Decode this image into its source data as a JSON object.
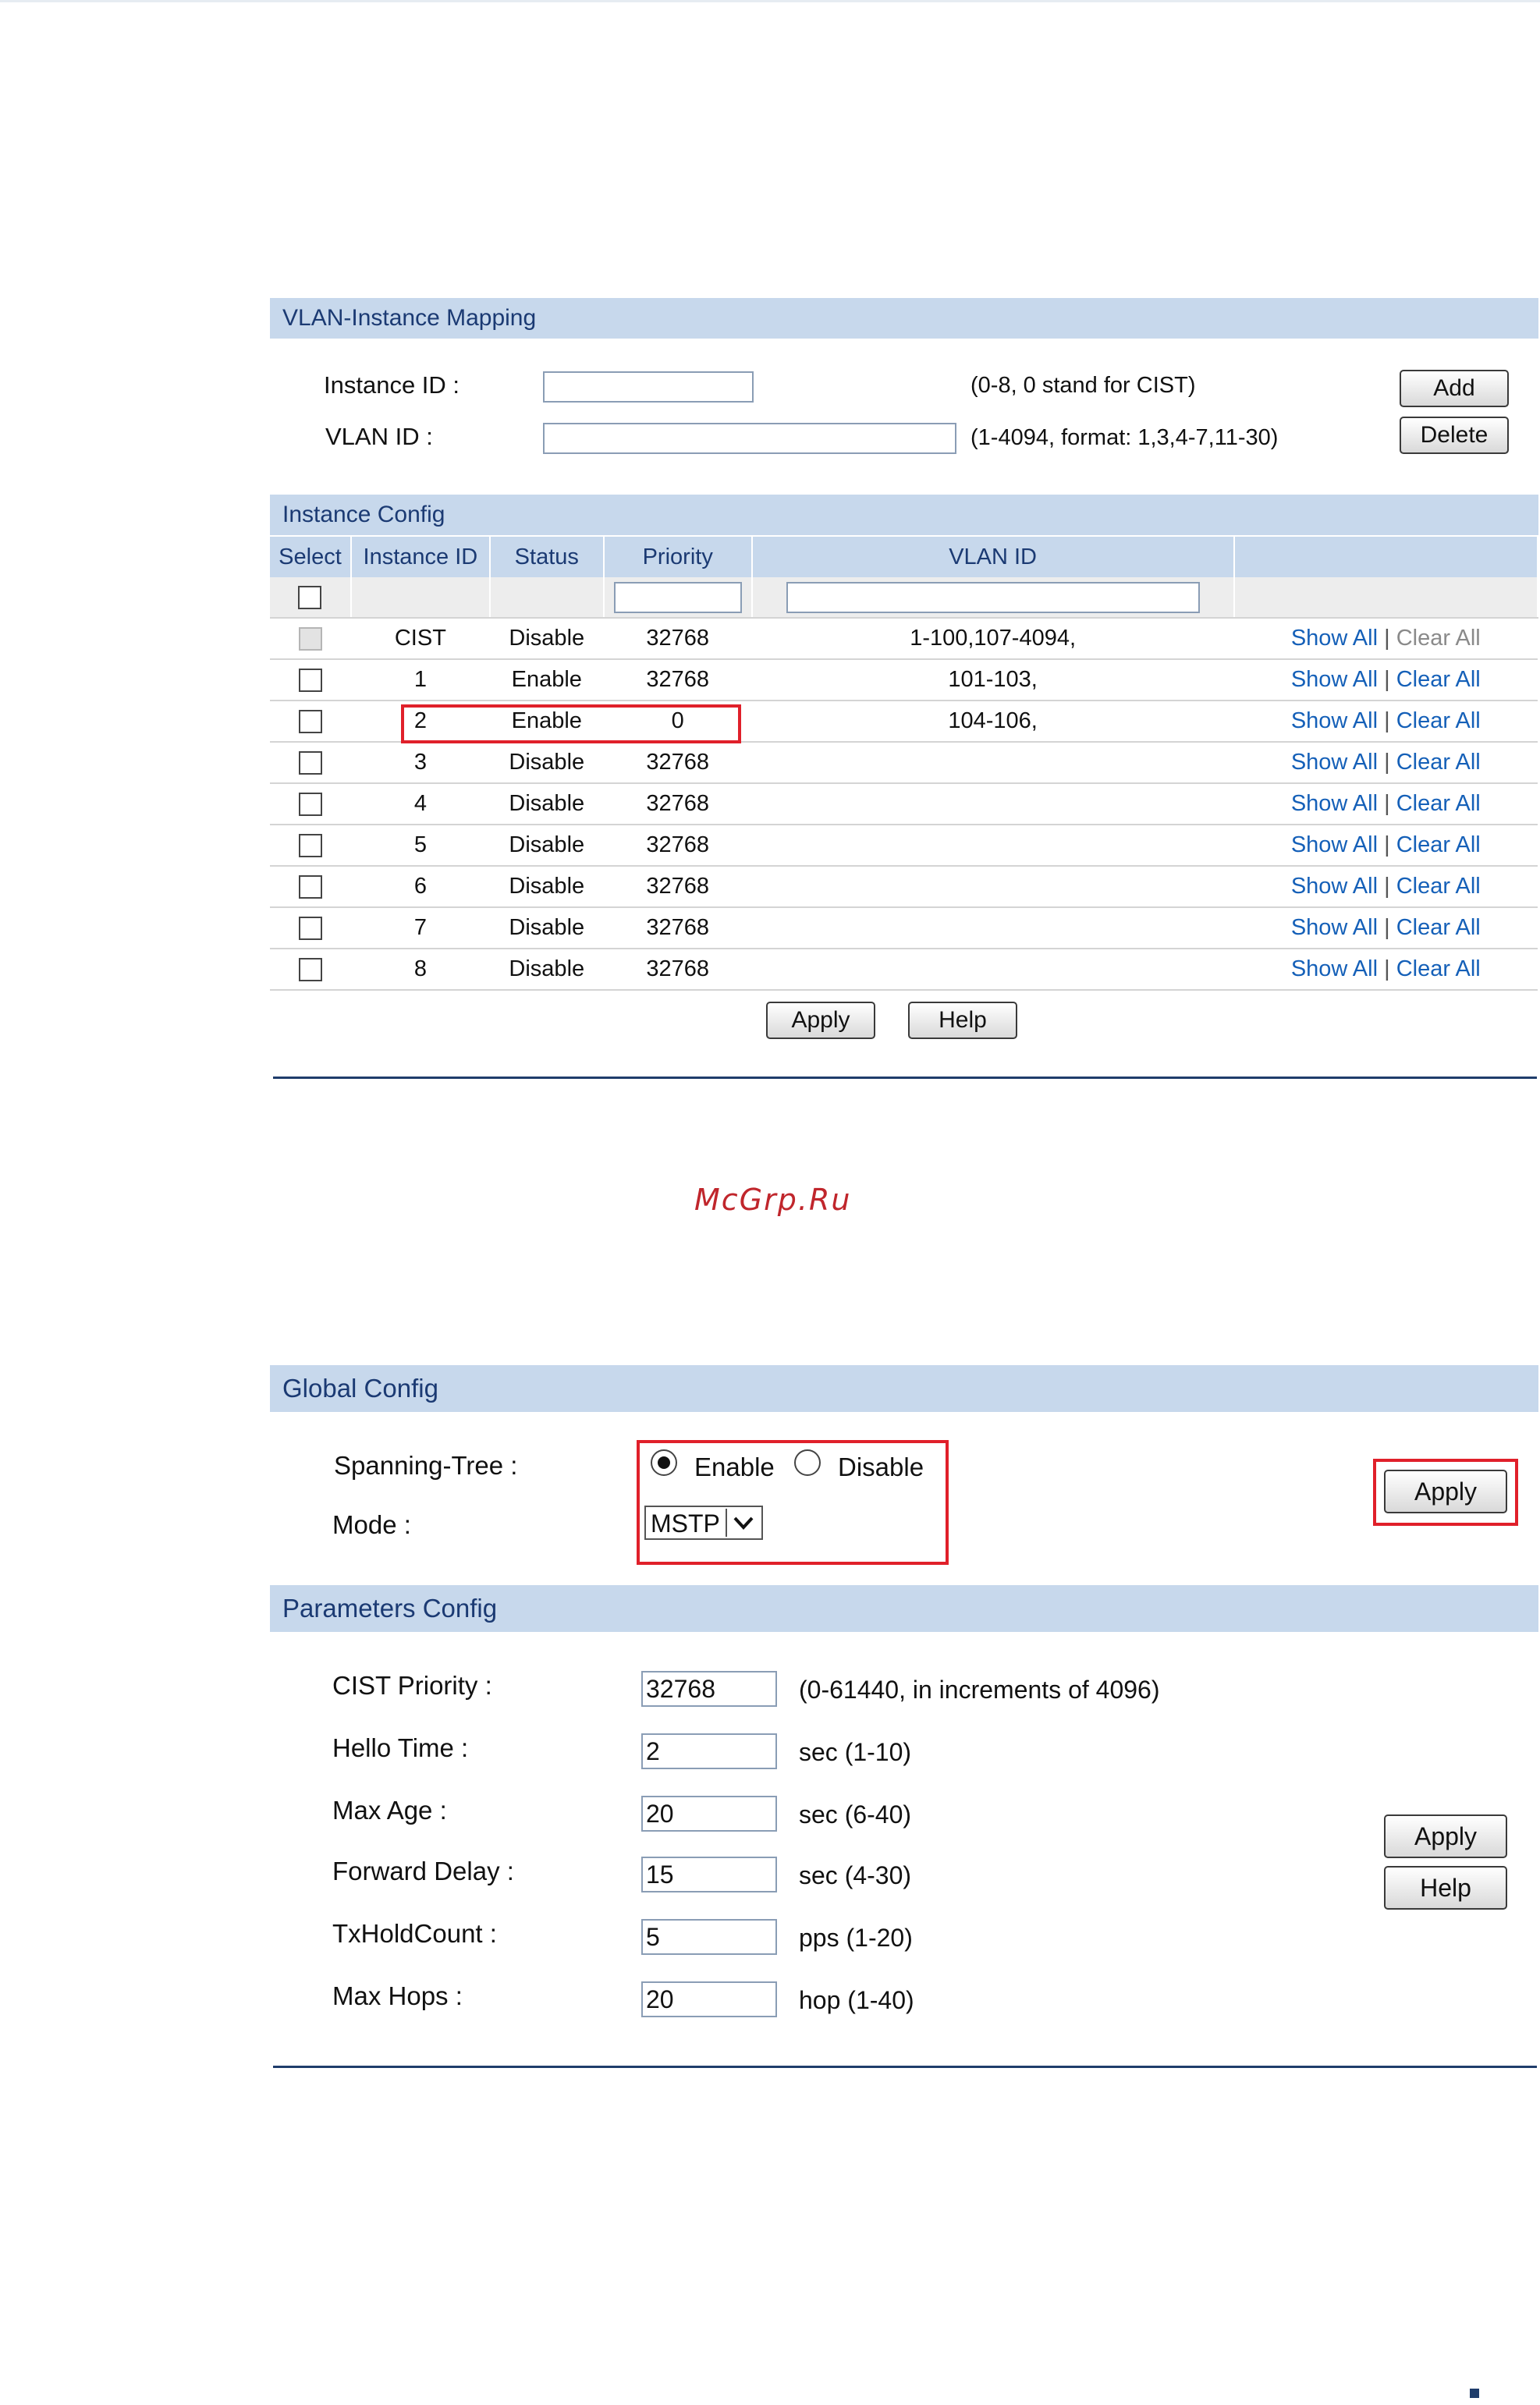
{
  "vlan_mapping": {
    "title": "VLAN-Instance Mapping",
    "instance_id_label": "Instance ID :",
    "instance_id_value": "",
    "instance_id_hint": "(0-8, 0 stand for CIST)",
    "vlan_id_label": "VLAN ID :",
    "vlan_id_value": "",
    "vlan_id_hint": "(1-4094, format: 1,3,4-7,11-30)",
    "add_label": "Add",
    "delete_label": "Delete"
  },
  "instance_config": {
    "title": "Instance Config",
    "columns": [
      "Select",
      "Instance ID",
      "Status",
      "Priority",
      "VLAN ID",
      ""
    ],
    "show_all_label": "Show All",
    "separator": "|",
    "clear_all_label": "Clear All",
    "rows": [
      {
        "id": "CIST",
        "status": "Disable",
        "priority": "32768",
        "vlan": "1-100,107-4094,"
      },
      {
        "id": "1",
        "status": "Enable",
        "priority": "32768",
        "vlan": "101-103,"
      },
      {
        "id": "2",
        "status": "Enable",
        "priority": "0",
        "vlan": "104-106,"
      },
      {
        "id": "3",
        "status": "Disable",
        "priority": "32768",
        "vlan": ""
      },
      {
        "id": "4",
        "status": "Disable",
        "priority": "32768",
        "vlan": ""
      },
      {
        "id": "5",
        "status": "Disable",
        "priority": "32768",
        "vlan": ""
      },
      {
        "id": "6",
        "status": "Disable",
        "priority": "32768",
        "vlan": ""
      },
      {
        "id": "7",
        "status": "Disable",
        "priority": "32768",
        "vlan": ""
      },
      {
        "id": "8",
        "status": "Disable",
        "priority": "32768",
        "vlan": ""
      }
    ],
    "apply_label": "Apply",
    "help_label": "Help"
  },
  "watermark": "McGrp.Ru",
  "global_config": {
    "title": "Global Config",
    "spanning_tree_label": "Spanning-Tree :",
    "enable_label": "Enable",
    "disable_label": "Disable",
    "mode_label": "Mode :",
    "mode_value": "MSTP",
    "apply_label": "Apply"
  },
  "parameters_config": {
    "title": "Parameters Config",
    "params": [
      {
        "label": "CIST Priority :",
        "value": "32768",
        "hint": "(0-61440, in increments of 4096)"
      },
      {
        "label": "Hello Time :",
        "value": "2",
        "hint": "sec (1-10)"
      },
      {
        "label": "Max Age :",
        "value": "20",
        "hint": "sec (6-40)"
      },
      {
        "label": "Forward Delay :",
        "value": "15",
        "hint": "sec (4-30)"
      },
      {
        "label": "TxHoldCount :",
        "value": "5",
        "hint": "pps (1-20)"
      },
      {
        "label": "Max Hops :",
        "value": "20",
        "hint": "hop (1-40)"
      }
    ],
    "apply_label": "Apply",
    "help_label": "Help"
  },
  "colors": {
    "header_bg": "#c7d8ec",
    "header_text": "#1b3a73",
    "highlight": "#e0202a",
    "link": "#1560b8"
  }
}
